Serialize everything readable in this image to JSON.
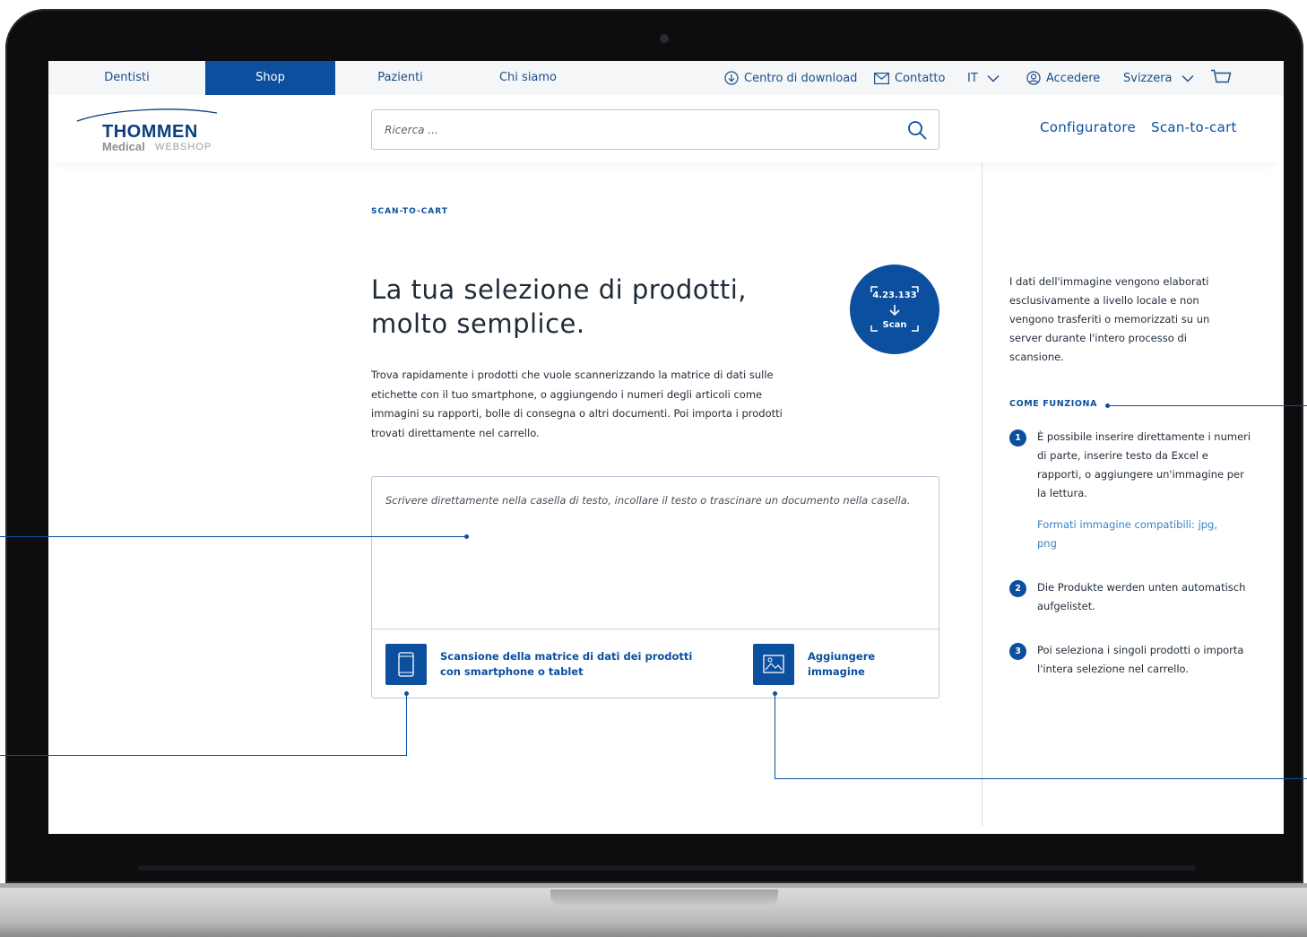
{
  "topbar": {
    "nav": [
      {
        "label": "Dentisti",
        "active": false
      },
      {
        "label": "Shop",
        "active": true
      },
      {
        "label": "Pazienti",
        "active": false
      },
      {
        "label": "Chi siamo",
        "active": false
      }
    ],
    "download": "Centro di download",
    "contact": "Contatto",
    "language": "IT",
    "login": "Accedere",
    "country": "Svizzera"
  },
  "header": {
    "logo": {
      "brand": "THOMMEN",
      "sub": "Medical",
      "suffix": "WEBSHOP"
    },
    "search_placeholder": "Ricerca ...",
    "links": [
      "Configuratore",
      "Scan-to-cart"
    ]
  },
  "main": {
    "eyebrow": "SCAN-TO-CART",
    "headline_line1": "La tua selezione di prodotti,",
    "headline_line2": "molto semplice.",
    "badge": {
      "code": "4.23.133",
      "label": "Scan"
    },
    "intro": "Trova rapidamente i prodotti che vuole scannerizzando la matrice di dati sulle etichette con il tuo smartphone, o aggiungendo i numeri degli articoli come immagini su rapporti, bolle di consegna o altri documenti. Poi importa i prodotti trovati direttamente nel carrello.",
    "upload_placeholder": "Scrivere direttamente nella casella di testo, incollare il testo o trascinare un documento nella casella.",
    "actions": [
      {
        "label": "Scansione della matrice di dati dei prodotti con smartphone o tablet",
        "icon": "smartphone-icon"
      },
      {
        "label": "Aggiungere immagine",
        "icon": "image-icon"
      }
    ]
  },
  "side": {
    "privacy": "I dati dell'immagine vengono elaborati esclusivamente a livello locale e non vengono trasferiti o memorizzati su un server durante l'intero processo di scansione.",
    "how_title": "COME FUNZIONA",
    "steps": [
      {
        "num": "1",
        "text": "È possibile inserire direttamente i numeri di parte, inserire testo da Excel e rapporti, o aggiungere un'immagine per la lettura.",
        "link": "Formati immagine compatibili: jpg, png"
      },
      {
        "num": "2",
        "text": "Die Produkte werden unten automatisch aufgelistet."
      },
      {
        "num": "3",
        "text": "Poi seleziona i singoli prodotti o importa l'intera selezione nel carrello."
      }
    ]
  },
  "colors": {
    "brand_blue": "#0b4f9e",
    "link_blue": "#3a83c6",
    "text": "#1f2b38"
  }
}
